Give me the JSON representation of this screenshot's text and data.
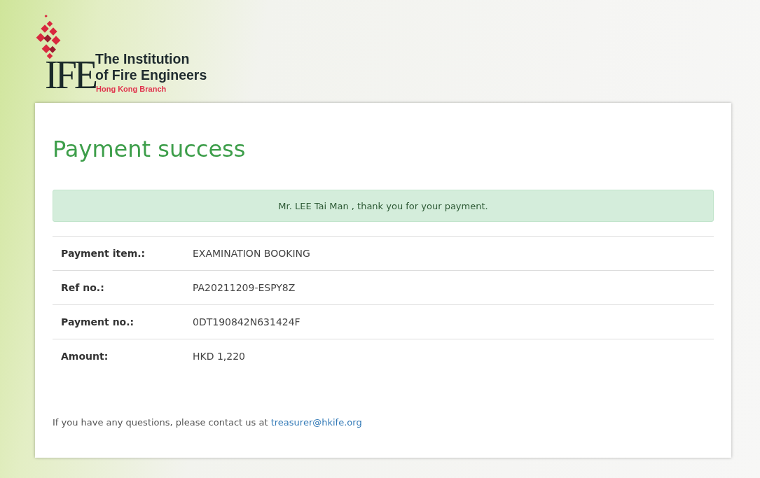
{
  "logo": {
    "monogram": "IFE",
    "name_lines": [
      "The Institution",
      "of Fire Engineers"
    ],
    "branch": "Hong Kong Branch"
  },
  "title": "Payment success",
  "alert": "Mr. LEE Tai Man , thank you for your payment.",
  "details": [
    {
      "label": "Payment item.:",
      "value": "EXAMINATION BOOKING"
    },
    {
      "label": "Ref no.:",
      "value": "PA20211209-ESPY8Z"
    },
    {
      "label": "Payment no.:",
      "value": "0DT190842N631424F"
    },
    {
      "label": "Amount:",
      "value": "HKD 1,220"
    }
  ],
  "footer": {
    "text": "If you have any questions, please contact us at",
    "link": "treasurer@hkife.org"
  }
}
